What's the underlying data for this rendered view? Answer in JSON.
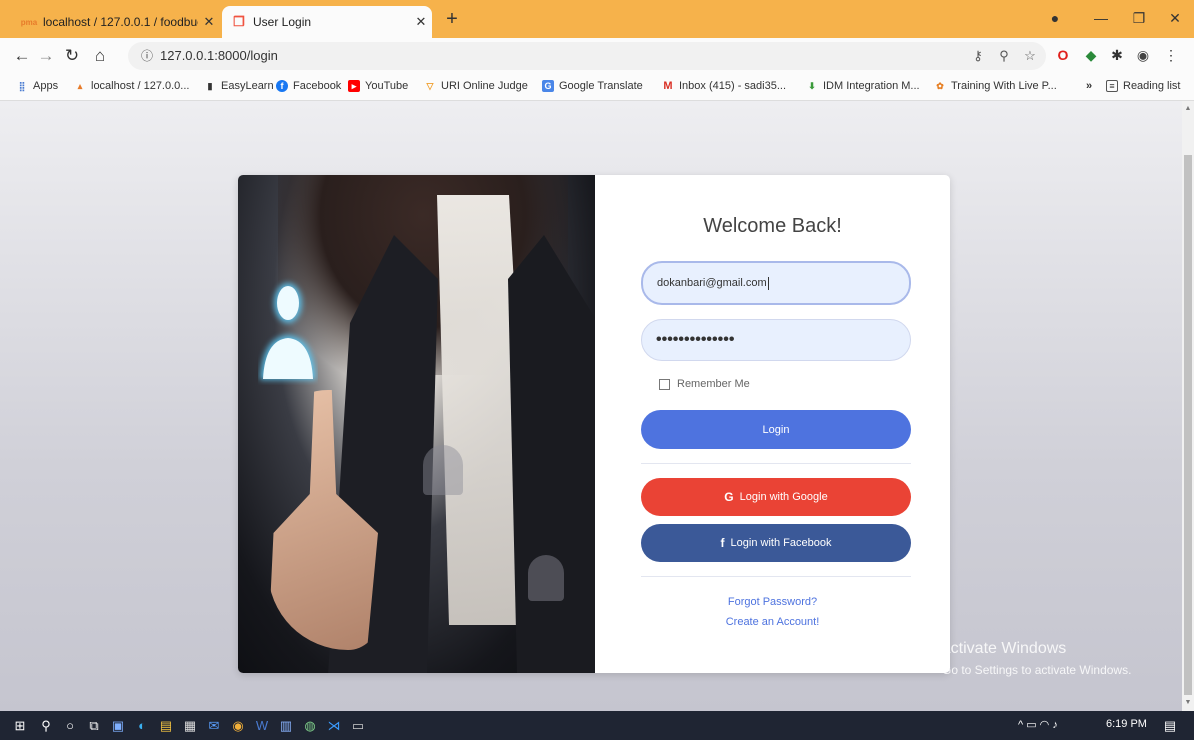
{
  "tabs": [
    {
      "label": "localhost / 127.0.0.1 / foodbucke",
      "favicon": "pma-icon"
    },
    {
      "label": "User Login",
      "favicon": "laravel-icon"
    }
  ],
  "address": {
    "url": "127.0.0.1:8000/login"
  },
  "bookmarks": [
    {
      "label": "Apps"
    },
    {
      "label": "localhost / 127.0.0..."
    },
    {
      "label": "EasyLearn"
    },
    {
      "label": "Facebook"
    },
    {
      "label": "YouTube"
    },
    {
      "label": "URI Online Judge"
    },
    {
      "label": "Google Translate"
    },
    {
      "label": "Inbox (415) - sadi35..."
    },
    {
      "label": "IDM Integration M..."
    },
    {
      "label": "Training With Live P..."
    },
    {
      "label": "Reading list"
    }
  ],
  "form": {
    "title": "Welcome Back!",
    "email_value": "dokanbari@gmail.com",
    "password_value": "••••••••••••••",
    "remember_label": "Remember Me",
    "login_label": "Login",
    "google_label": "Login with Google",
    "facebook_label": "Login with Facebook",
    "forgot_label": "Forgot Password?",
    "create_label": "Create an Account!"
  },
  "watermark": {
    "line1": "Activate Windows",
    "line2": "Go to Settings to activate Windows."
  },
  "tray": {
    "time": "6:19 PM"
  },
  "colors": {
    "primary": "#4e73df",
    "google": "#ea4335",
    "facebook": "#3b5998",
    "tabbar": "#f6b24b"
  }
}
